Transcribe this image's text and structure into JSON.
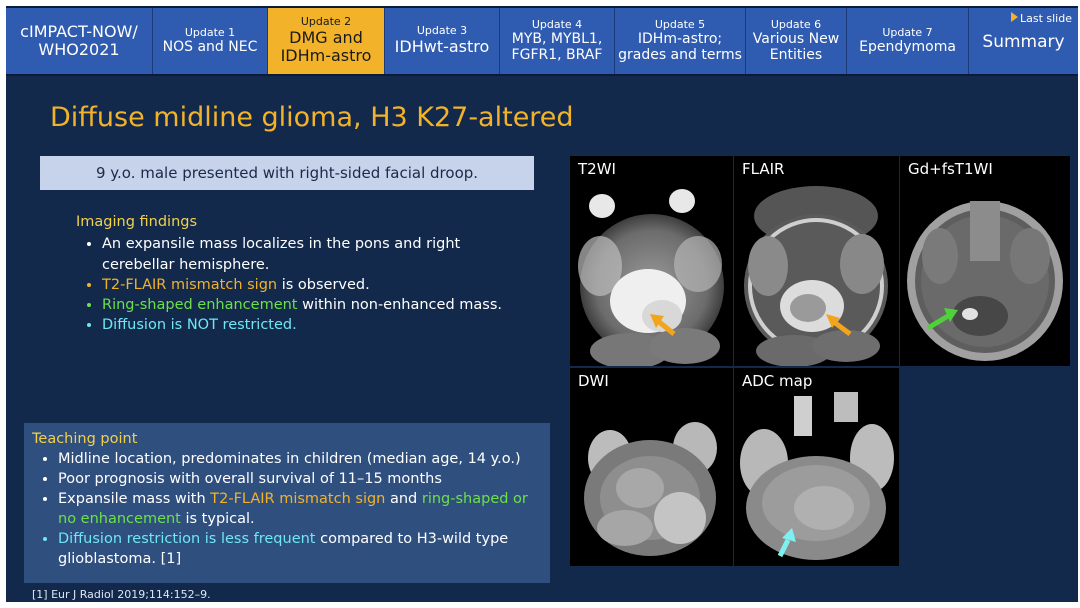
{
  "nav": {
    "home": {
      "line1": "cIMPACT-NOW/",
      "line2": "WHO2021"
    },
    "tabs": [
      {
        "num": "Update 1",
        "title1": "NOS and NEC",
        "title2": ""
      },
      {
        "num": "Update 2",
        "title1": "DMG and",
        "title2": "IDHm-astro"
      },
      {
        "num": "Update 3",
        "title1": "IDHwt-astro",
        "title2": ""
      },
      {
        "num": "Update 4",
        "title1": "MYB, MYBL1,",
        "title2": "FGFR1, BRAF"
      },
      {
        "num": "Update 5",
        "title1": "IDHm-astro;",
        "title2": "grades and terms"
      },
      {
        "num": "Update 6",
        "title1": "Various New",
        "title2": "Entities"
      },
      {
        "num": "Update 7",
        "title1": "Ependymoma",
        "title2": ""
      }
    ],
    "summary": "Summary",
    "last_slide": "Last slide"
  },
  "title": "Diffuse midline glioma, H3 K27-altered",
  "case": "9 y.o. male presented with right-sided facial droop.",
  "imaging": {
    "heading": "Imaging findings",
    "b1": "An expansile mass localizes in the pons and right cerebellar hemisphere.",
    "b2_hl": "T2-FLAIR mismatch sign",
    "b2_rest": " is observed.",
    "b3_hl": "Ring-shaped enhancement",
    "b3_rest": " within non-enhanced mass.",
    "b4": "Diffusion is NOT restricted."
  },
  "teaching": {
    "heading": "Teaching point",
    "b1": "Midline location, predominates in children (median age, 14 y.o.)",
    "b2": "Poor prognosis with overall survival of 11–15 months",
    "b3_a": "Expansile mass with ",
    "b3_hl1": "T2-FLAIR mismatch sign",
    "b3_b": " and ",
    "b3_hl2": "ring-shaped or no enhancement",
    "b3_c": " is typical.",
    "b4_hl": "Diffusion restriction is less frequent",
    "b4_rest": " compared to H3-wild type glioblastoma. [1]"
  },
  "reference": "[1] Eur J Radiol 2019;114:152–9.",
  "panels": {
    "t2": "T2WI",
    "flair": "FLAIR",
    "gd": "Gd+fsT1WI",
    "dwi": "DWI",
    "adc": "ADC map"
  },
  "colors": {
    "background": "#13294b",
    "tab": "#2f5bb0",
    "active_tab": "#f2b32a",
    "title": "#f2b32a",
    "highlight_orange": "#f2b32a",
    "highlight_green": "#6de04a",
    "highlight_cyan": "#6fe6f2",
    "arrow_orange": "#f2a51c",
    "arrow_green": "#4fd13a",
    "arrow_cyan": "#7ff0f2"
  }
}
